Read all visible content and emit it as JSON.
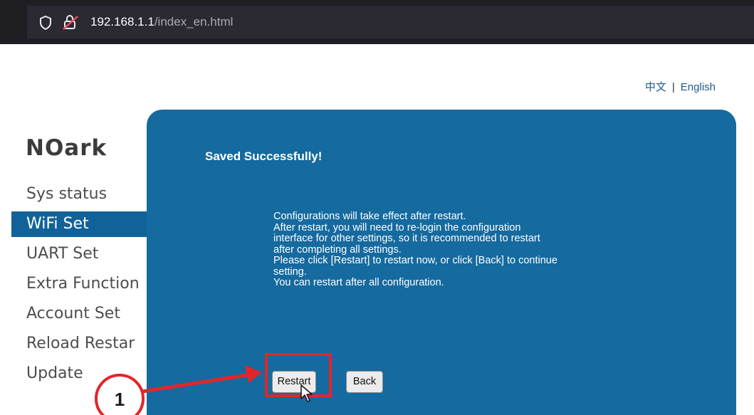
{
  "browser": {
    "url_host": "192.168.1.1",
    "url_path": "/index_en.html"
  },
  "lang": {
    "chinese": "中文",
    "separator": "|",
    "english": "English"
  },
  "logo": "NOark",
  "sidebar": {
    "items": [
      {
        "label": "Sys status",
        "active": false
      },
      {
        "label": "WiFi Set",
        "active": true
      },
      {
        "label": "UART Set",
        "active": false
      },
      {
        "label": "Extra Function",
        "active": false
      },
      {
        "label": "Account Set",
        "active": false
      },
      {
        "label": "Reload Restar",
        "active": false
      },
      {
        "label": "Update",
        "active": false
      }
    ]
  },
  "panel": {
    "title": "Saved Successfully!",
    "message_lines": [
      "Configurations will take effect after restart.",
      "After restart, you will need to re-login the configuration",
      "interface for other settings, so it is recommended to restart",
      "after completing all settings.",
      "Please click [Restart] to restart now, or click [Back] to continue",
      "setting.",
      "You can restart after all configuration."
    ],
    "restart_label": "Restart",
    "back_label": "Back"
  },
  "annotation": {
    "step_number": "1"
  },
  "colors": {
    "panel_blue": "#156a9f",
    "active_item": "#12629a",
    "annotation_red": "#e0262b"
  }
}
